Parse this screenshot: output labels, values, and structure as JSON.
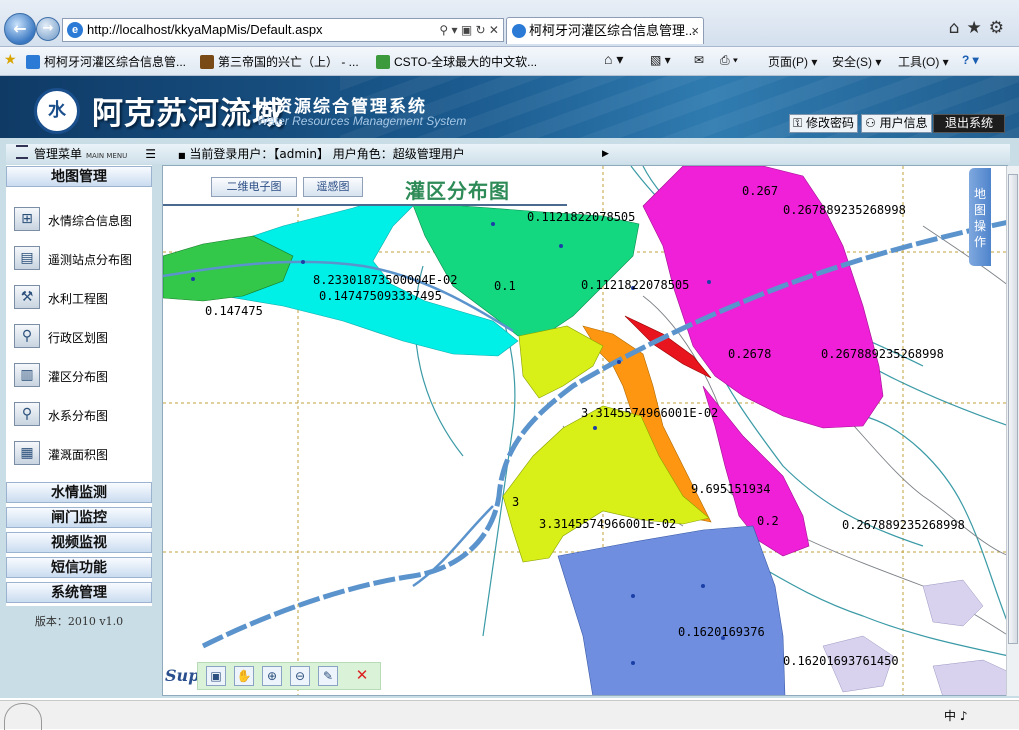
{
  "browser": {
    "address": "http://localhost/kkyaMapMis/Default.aspx",
    "address_icons": "⚲ ▾ ▣ ↻ ✕",
    "tab_title": "柯柯牙河灌区综合信息管理...",
    "tab_close": "×",
    "favorites": [
      {
        "label": "柯柯牙河灌区综合信息管..."
      },
      {
        "label": "第三帝国的兴亡（上） - ..."
      },
      {
        "label": "CSTO-全球最大的中文软..."
      }
    ],
    "commands": {
      "page": "页面(P)",
      "safety": "安全(S)",
      "tools": "工具(O)"
    },
    "status_right": "中 ♪"
  },
  "header": {
    "title": "阿克苏河流域",
    "subtitle": "水资源综合管理系统",
    "subtitle_en": "Water Resources Management System",
    "buttons": {
      "change_password": "修改密码",
      "user_info": "用户信息",
      "logout": "退出系统"
    }
  },
  "menu": {
    "header": "管理菜单",
    "header_en": "MAIN MENU",
    "info": "当前登录用户：【admin】 用户角色：超级管理用户",
    "sections": {
      "map": "地图管理",
      "water": "水情监测",
      "gate": "闸门监控",
      "video": "视频监视",
      "sms": "短信功能",
      "system": "系统管理"
    },
    "items": [
      {
        "label": "水情综合信息图",
        "icon": "⊞"
      },
      {
        "label": "遥测站点分布图",
        "icon": "▤"
      },
      {
        "label": "水利工程图",
        "icon": "⚒"
      },
      {
        "label": "行政区划图",
        "icon": "⚲"
      },
      {
        "label": "灌区分布图",
        "icon": "▥"
      },
      {
        "label": "水系分布图",
        "icon": "⚲"
      },
      {
        "label": "灌溉面积图",
        "icon": "▦"
      }
    ],
    "version": "版本：2010 v1.0"
  },
  "map": {
    "tabs": {
      "vector": "二维电子图",
      "remote": "遥感图"
    },
    "title": "灌区分布图",
    "side_tab": "地图操作",
    "logo_text": "Sup",
    "colors": {
      "cyan": "#00f0e8",
      "lightgreen": "#33c84a",
      "green": "#14d880",
      "magenta": "#ef20d7",
      "orange": "#ff9612",
      "yellow": "#d8f018",
      "blue": "#6f8ee0",
      "red": "#e8141e",
      "road": "#5b93cc",
      "grid": "#c2a03c"
    },
    "labels": {
      "l1": "0.1121822078505",
      "l2": "0.267",
      "l3": "0.267889235268998",
      "l4": "8.23301873500004E-02",
      "l5": "0.147475093337495",
      "l6": "0.147475",
      "l7": "0.1",
      "l8": "0.1121822078505",
      "l9": "0.2678",
      "l10": "0.267889235268998",
      "l11": "3.3145574966001E-02",
      "l12": "9.695151934",
      "l13": "3.3145574966001E-02",
      "l14": "0.2",
      "l15": "0.267889235268998",
      "l16": "0.1620169376",
      "l17": "0.16201693761450",
      "l18": "3"
    },
    "tools": [
      "▣",
      "✋",
      "⊕",
      "⊖",
      "✎",
      "✕"
    ]
  }
}
